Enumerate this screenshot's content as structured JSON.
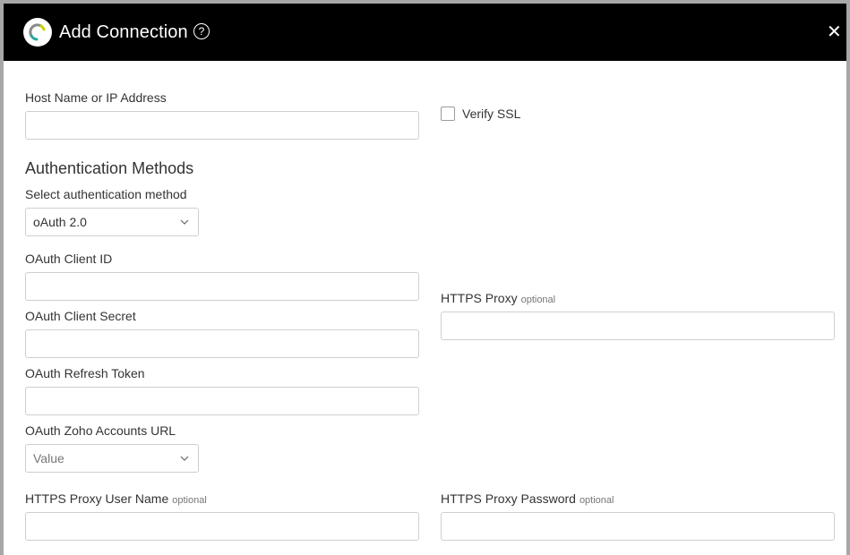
{
  "header": {
    "title": "Add Connection",
    "help_glyph": "?",
    "close_glyph": "✕",
    "background_color": "#000000"
  },
  "host": {
    "label": "Host Name or IP Address",
    "value": ""
  },
  "verify_ssl": {
    "label": "Verify SSL",
    "checked": false
  },
  "auth": {
    "section_title": "Authentication Methods",
    "method_label": "Select authentication method",
    "method_value": "oAuth 2.0"
  },
  "oauth_client_id": {
    "label": "OAuth Client ID",
    "value": ""
  },
  "oauth_client_secret": {
    "label": "OAuth Client Secret",
    "value": ""
  },
  "oauth_refresh_token": {
    "label": "OAuth Refresh Token",
    "value": ""
  },
  "oauth_zoho_url": {
    "label": "OAuth Zoho Accounts URL",
    "placeholder": "Value"
  },
  "https_proxy": {
    "label": "HTTPS Proxy",
    "optional": "optional",
    "value": ""
  },
  "https_proxy_user": {
    "label": "HTTPS Proxy User Name",
    "optional": "optional",
    "value": ""
  },
  "https_proxy_password": {
    "label": "HTTPS Proxy Password",
    "optional": "optional",
    "value": ""
  }
}
